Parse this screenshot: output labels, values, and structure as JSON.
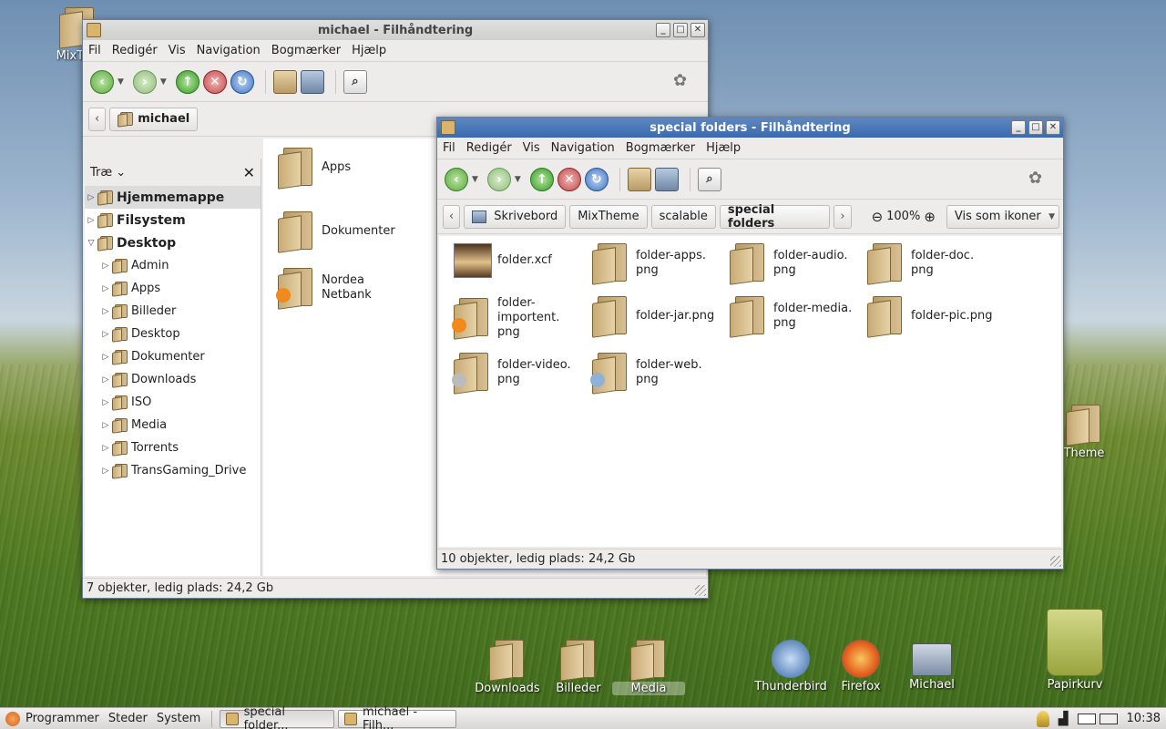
{
  "desktop": {
    "icons": [
      {
        "label": "MixThe"
      },
      {
        "label": "Theme"
      },
      {
        "label": "Downloads"
      },
      {
        "label": "Billeder"
      },
      {
        "label": "Media"
      },
      {
        "label": "Thunderbird"
      },
      {
        "label": "Firefox"
      },
      {
        "label": "Michael"
      },
      {
        "label": "Papirkurv"
      }
    ]
  },
  "menu": [
    "Fil",
    "Redigér",
    "Vis",
    "Navigation",
    "Bogmærker",
    "Hjælp"
  ],
  "win_back": {
    "title": "michael - Filhåndtering",
    "location": "michael",
    "sidebar_mode": "Træ",
    "tree": [
      {
        "label": "Hjemmemappe"
      },
      {
        "label": "Filsystem"
      },
      {
        "label": "Desktop"
      },
      {
        "label": "Admin"
      },
      {
        "label": "Apps"
      },
      {
        "label": "Billeder"
      },
      {
        "label": "Desktop"
      },
      {
        "label": "Dokumenter"
      },
      {
        "label": "Downloads"
      },
      {
        "label": "ISO"
      },
      {
        "label": "Media"
      },
      {
        "label": "Torrents"
      },
      {
        "label": "TransGaming_Drive"
      }
    ],
    "files": [
      {
        "label": "Apps"
      },
      {
        "label": "Dokumenter"
      },
      {
        "label": "Nordea\nNetbank"
      }
    ],
    "status": "7 objekter, ledig plads: 24,2 Gb"
  },
  "win_front": {
    "title": "special folders - Filhåndtering",
    "crumbs": [
      "Skrivebord",
      "MixTheme",
      "scalable",
      "special folders"
    ],
    "zoom": "100%",
    "view_mode": "Vis som ikoner",
    "files": [
      {
        "label": "folder.xcf"
      },
      {
        "label": "folder-apps.\npng"
      },
      {
        "label": "folder-audio.\npng"
      },
      {
        "label": "folder-doc.\npng"
      },
      {
        "label": "folder-\nimportent.\npng"
      },
      {
        "label": "folder-jar.png"
      },
      {
        "label": "folder-media.\npng"
      },
      {
        "label": "folder-pic.png"
      },
      {
        "label": "folder-video.\npng"
      },
      {
        "label": "folder-web.\npng"
      }
    ],
    "status": "10 objekter, ledig plads: 24,2 Gb"
  },
  "panel": {
    "menus": [
      "Programmer",
      "Steder",
      "System"
    ],
    "tasks": [
      "special folder...",
      "michael - Filh..."
    ],
    "clock": "10:38"
  }
}
